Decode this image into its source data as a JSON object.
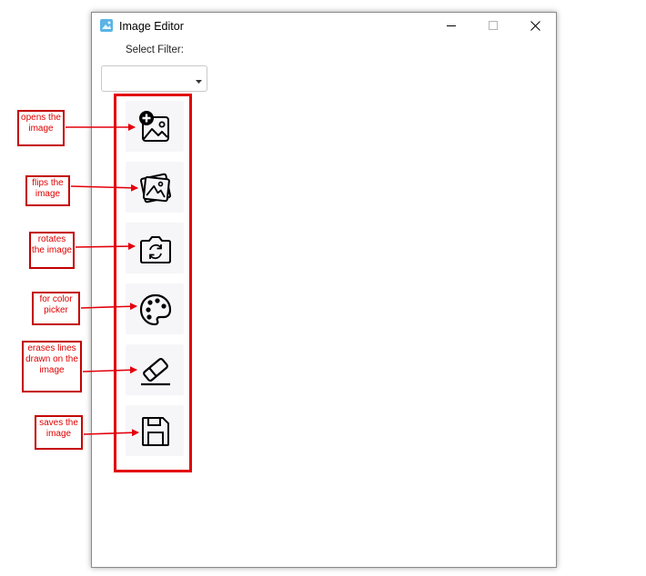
{
  "window": {
    "title": "Image Editor",
    "icon": "image-app-icon"
  },
  "filter": {
    "label": "Select Filter:",
    "selected": ""
  },
  "tools": [
    {
      "id": "open",
      "icon": "image-add-icon"
    },
    {
      "id": "flip",
      "icon": "image-stack-icon"
    },
    {
      "id": "rotate",
      "icon": "camera-rotate-icon"
    },
    {
      "id": "color",
      "icon": "palette-icon"
    },
    {
      "id": "erase",
      "icon": "eraser-icon"
    },
    {
      "id": "save",
      "icon": "floppy-disk-icon"
    }
  ],
  "annotations": [
    {
      "text": "opens the image"
    },
    {
      "text": "flips the image"
    },
    {
      "text": "rotates the image"
    },
    {
      "text": "for color picker"
    },
    {
      "text": "erases lines drawn on the image"
    },
    {
      "text": "saves the image"
    }
  ],
  "colors": {
    "annotation": "#e3000b",
    "button_bg": "#f6f6f8",
    "app_icon": "#5ab4e6"
  }
}
